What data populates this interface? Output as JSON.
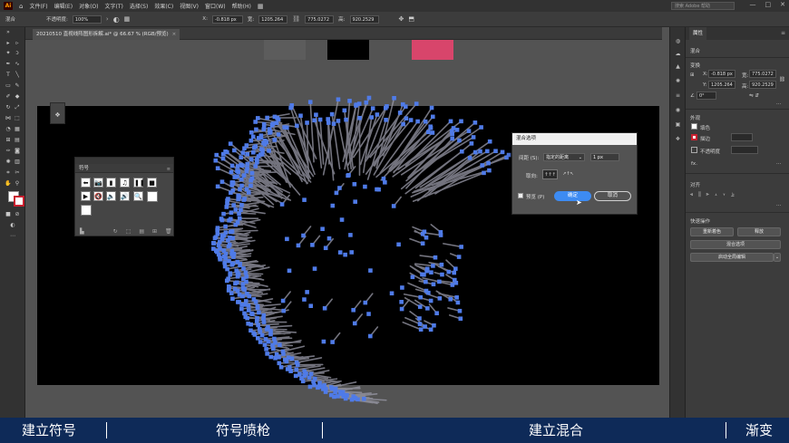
{
  "app": {
    "logo": "Ai"
  },
  "menubar": {
    "items": [
      "文件(F)",
      "编辑(E)",
      "对象(O)",
      "文字(T)",
      "选择(S)",
      "效果(C)",
      "视图(V)",
      "窗口(W)",
      "帮助(H)"
    ],
    "search_placeholder": "搜索 Adobe 帮助",
    "win_controls": [
      "—",
      "□",
      "✕"
    ]
  },
  "controlbar": {
    "selection": "混合",
    "opacity_label": "不透明度:",
    "opacity_value": "100%",
    "x_label": "X:",
    "x_value": "-0.818 px",
    "w_label": "宽:",
    "w_value": "1205.264",
    "y_label": "Y:",
    "y_value": "775.0272",
    "h_label": "高:",
    "h_value": "920.2529"
  },
  "document_tab": {
    "title": "20210510 直视线阵图形拆解.ai* @ 66.67 % (RGB/预览)",
    "close": "×"
  },
  "swatches": {
    "gray": "#5c5c5c",
    "black": "#000000",
    "pink": "#d8456b"
  },
  "symbols_panel": {
    "title": "符号",
    "menu_icon": "≡",
    "symbols": [
      "⬅",
      "📷",
      "▮",
      "♫",
      "❚❚",
      "■",
      "▶",
      "🔇",
      "🔈",
      "🔊",
      "🔍",
      ""
    ],
    "footer_icons": [
      "▙",
      "↻",
      "⬚",
      "▤",
      "⊞",
      "🗑"
    ]
  },
  "blend_dialog": {
    "title": "混合选项",
    "spacing_label": "间距 (S):",
    "spacing_value": "指定的距离",
    "distance_value": "1 px",
    "orientation_label": "取向:",
    "preview_label": "预览 (P)",
    "ok_label": "确定",
    "cancel_label": "取消"
  },
  "properties_panel": {
    "tab_title": "属性",
    "section_mixed": "混合",
    "section_transform": "变换",
    "x_label": "X:",
    "x_value": "-0.818 px",
    "w_label": "宽:",
    "w_value": "775.0272",
    "y_label": "Y:",
    "y_value": "1205.264",
    "h_label": "高:",
    "h_value": "920.2529",
    "angle_value": "0°",
    "section_appearance": "外观",
    "fill_label": "填色",
    "stroke_label": "描边",
    "opacity_label": "不透明度",
    "fx_label": "fx.",
    "section_align": "对齐",
    "section_quick": "快速操作",
    "expand_button": "重新着色",
    "release_button": "释放",
    "blend_options_button": "混合选项",
    "global_edit_button": "启动全局编辑"
  },
  "subtitles": {
    "s1": "建立符号",
    "s2": "符号喷枪",
    "s3": "建立混合",
    "s4": "渐变"
  },
  "colors": {
    "accent_blue": "#3d8bf2",
    "dot_blue": "#4f7be8",
    "subtitle_bar": "#0e2a58"
  }
}
